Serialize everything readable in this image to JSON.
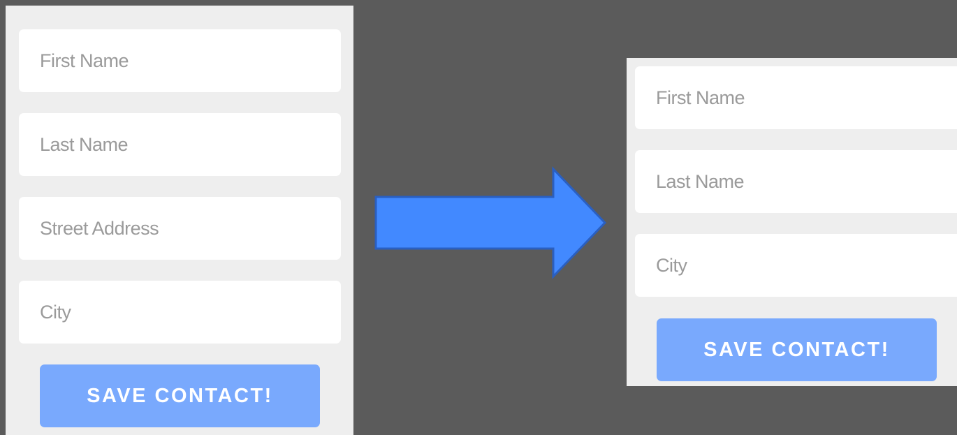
{
  "before_form": {
    "fields": [
      {
        "placeholder": "First Name"
      },
      {
        "placeholder": "Last Name"
      },
      {
        "placeholder": "Street Address"
      },
      {
        "placeholder": "City"
      }
    ],
    "submit_label": "SAVE CONTACT!"
  },
  "after_form": {
    "fields": [
      {
        "placeholder": "First Name"
      },
      {
        "placeholder": "Last Name"
      },
      {
        "placeholder": "City"
      }
    ],
    "submit_label": "SAVE CONTACT!"
  },
  "arrow": {
    "icon": "right-arrow-icon",
    "fill": "#4289ff",
    "stroke": "#2a5fc0"
  },
  "colors": {
    "background": "#5b5b5b",
    "panel": "#eeeeee",
    "field": "#ffffff",
    "placeholder_text": "#9a9a9a",
    "button": "#79a9fd",
    "button_text": "#ffffff"
  }
}
